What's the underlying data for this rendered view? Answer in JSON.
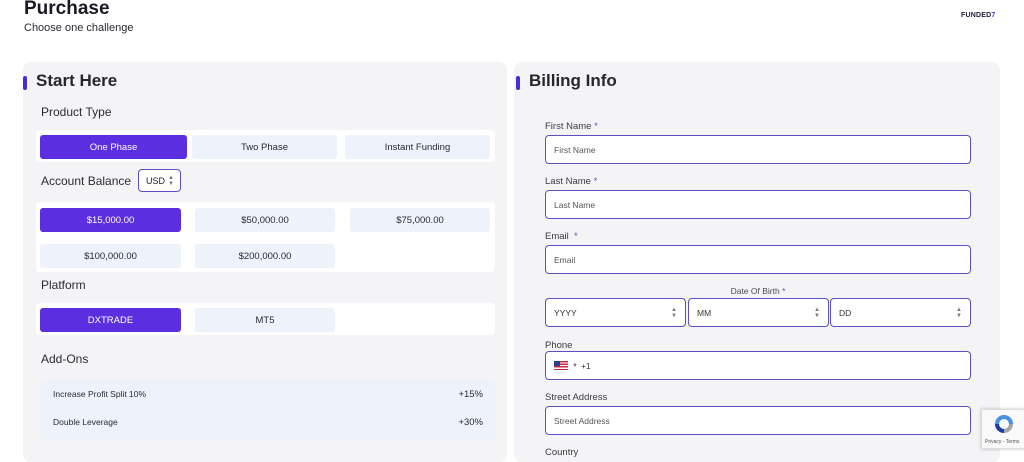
{
  "header": {
    "title": "Purchase",
    "subtitle": "Choose one challenge",
    "logo_main": "FUNDED",
    "logo_accent": "7"
  },
  "start_here": {
    "heading": "Start Here",
    "product_type_label": "Product Type",
    "product_types": [
      "One Phase",
      "Two Phase",
      "Instant Funding"
    ],
    "account_balance_label": "Account Balance",
    "currency": "USD",
    "balances": [
      "$15,000.00",
      "$50,000.00",
      "$75,000.00",
      "$100,000.00",
      "$200,000.00"
    ],
    "platform_label": "Platform",
    "platforms": [
      "DXTRADE",
      "MT5"
    ],
    "addons_label": "Add-Ons",
    "addons": [
      {
        "name": "Increase Profit Split 10%",
        "price": "+15%"
      },
      {
        "name": "Double Leverage",
        "price": "+30%"
      }
    ]
  },
  "billing": {
    "heading": "Billing Info",
    "first_name_label": "First Name",
    "first_name_placeholder": "First Name",
    "last_name_label": "Last Name",
    "last_name_placeholder": "Last Name",
    "email_label": "Email",
    "email_placeholder": "Email",
    "dob_label": "Date Of Birth",
    "dob_year": "YYYY",
    "dob_month": "MM",
    "dob_day": "DD",
    "phone_label": "Phone",
    "phone_code": "+1",
    "street_label": "Street Address",
    "street_placeholder": "Street Address",
    "country_label": "Country",
    "required_mark": "*"
  },
  "recaptcha": {
    "links": "Privacy - Terms"
  },
  "colors": {
    "accent": "#5b2ee0",
    "panel_bg": "#f4f4f6",
    "option_bg": "#eef2fa",
    "border": "#5a4fc4"
  }
}
